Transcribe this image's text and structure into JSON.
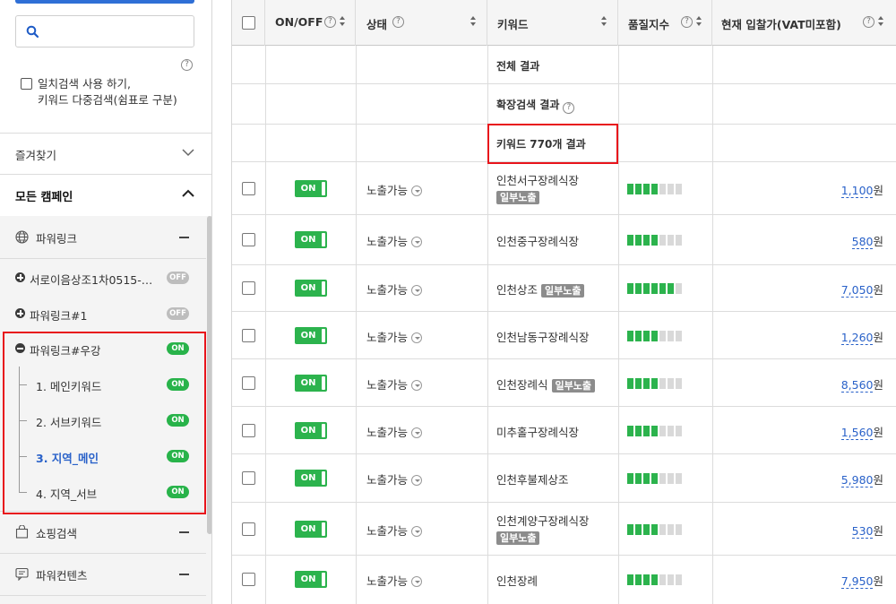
{
  "sidebar": {
    "help_glyph": "?",
    "exact_search": {
      "line1": "일치검색 사용 하기,",
      "line2": "키워드 다중검색(쉼표로 구분)"
    },
    "favorites_label": "즐겨찾기",
    "all_campaigns_label": "모든 캠페인",
    "categories": {
      "powerlink": "파워링크",
      "shopping": "쇼핑검색",
      "powercontents": "파워컨텐츠"
    },
    "campaigns": [
      {
        "label": "서로이음상조1차0515-…",
        "toggle": "OFF"
      },
      {
        "label": "파워링크#1",
        "toggle": "OFF"
      },
      {
        "label": "파워링크#우강",
        "toggle": "ON"
      }
    ],
    "adgroups": [
      {
        "label": "1. 메인키워드",
        "toggle": "ON"
      },
      {
        "label": "2. 서브키워드",
        "toggle": "ON"
      },
      {
        "label": "3. 지역_메인",
        "toggle": "ON"
      },
      {
        "label": "4. 지역_서브",
        "toggle": "ON"
      }
    ]
  },
  "table": {
    "headers": {
      "onoff": "ON/OFF",
      "status": "상태",
      "keyword": "키워드",
      "quality": "품질지수",
      "bid": "현재 입찰가(VAT미포함)"
    },
    "help_glyph": "?",
    "summary": {
      "total": "전체 결과",
      "extended": "확장검색 결과",
      "keyword_count": "키워드 770개 결과"
    },
    "rows": [
      {
        "toggle": "ON",
        "status": "노출가능",
        "keyword": "인천서구장례식장",
        "tag": "일부노출",
        "quality": 4,
        "bid": "1,100",
        "unit": "원"
      },
      {
        "toggle": "ON",
        "status": "노출가능",
        "keyword": "인천중구장례식장",
        "tag": "",
        "quality": 4,
        "bid": "580",
        "unit": "원"
      },
      {
        "toggle": "ON",
        "status": "노출가능",
        "keyword": "인천상조",
        "tag": "일부노출",
        "quality": 6,
        "bid": "7,050",
        "unit": "원"
      },
      {
        "toggle": "ON",
        "status": "노출가능",
        "keyword": "인천남동구장례식장",
        "tag": "",
        "quality": 4,
        "bid": "1,260",
        "unit": "원"
      },
      {
        "toggle": "ON",
        "status": "노출가능",
        "keyword": "인천장례식",
        "tag": "일부노출",
        "quality": 4,
        "bid": "8,560",
        "unit": "원"
      },
      {
        "toggle": "ON",
        "status": "노출가능",
        "keyword": "미추홀구장례식장",
        "tag": "",
        "quality": 4,
        "bid": "1,560",
        "unit": "원"
      },
      {
        "toggle": "ON",
        "status": "노출가능",
        "keyword": "인천후불제상조",
        "tag": "",
        "quality": 4,
        "bid": "5,980",
        "unit": "원"
      },
      {
        "toggle": "ON",
        "status": "노출가능",
        "keyword": "인천계양구장례식장",
        "tag": "일부노출",
        "quality": 4,
        "bid": "530",
        "unit": "원"
      },
      {
        "toggle": "ON",
        "status": "노출가능",
        "keyword": "인천장례",
        "tag": "",
        "quality": 4,
        "bid": "7,950",
        "unit": "원"
      }
    ]
  },
  "colors": {
    "accent": "#2a62c9",
    "on_green": "#2cb34d",
    "highlight_red": "#e8141b",
    "tag_grey": "#8c8c8c"
  }
}
